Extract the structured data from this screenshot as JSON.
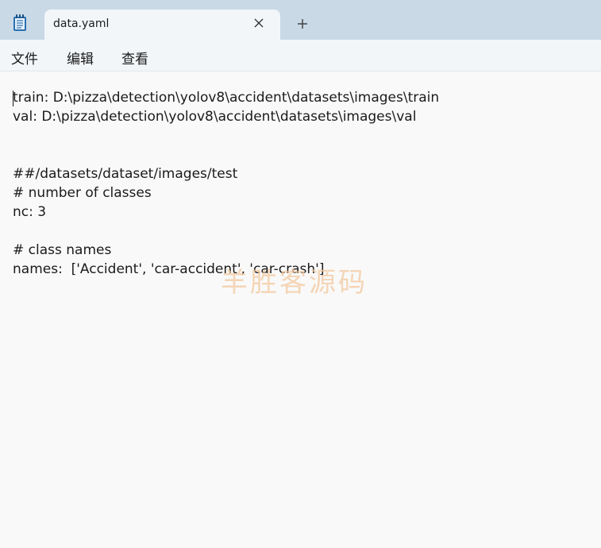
{
  "tab": {
    "title": "data.yaml"
  },
  "menu": {
    "items": [
      "文件",
      "编辑",
      "查看"
    ]
  },
  "editor": {
    "lines": [
      "train: D:\\pizza\\detection\\yolov8\\accident\\datasets\\images\\train",
      "val: D:\\pizza\\detection\\yolov8\\accident\\datasets\\images\\val",
      "",
      "",
      "##/datasets/dataset/images/test",
      "# number of classes",
      "nc: 3",
      "",
      "# class names",
      "names:  ['Accident', 'car-accident', 'car-crash']"
    ]
  },
  "watermark": "羊胜客源码",
  "icons": {
    "app": "notepad-icon",
    "close": "close-icon",
    "new_tab": "plus-icon"
  },
  "colors": {
    "titlebar": "#c9d9e6",
    "tab": "#f3f6f9",
    "editor_bg": "#f9f9f9",
    "text": "#1b1b1b",
    "watermark": "#f3c9a0"
  }
}
